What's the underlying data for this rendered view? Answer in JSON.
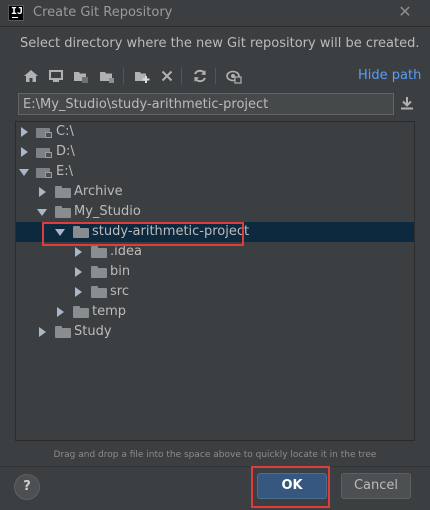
{
  "window": {
    "title": "Create Git Repository",
    "app_icon_letters": "IJ",
    "close_glyph": "✕"
  },
  "description": "Select directory where the new Git repository will be created.",
  "toolbar": {
    "icons": [
      "home-icon",
      "desktop-icon",
      "project-folder-icon",
      "module-folder-icon",
      "new-folder-icon",
      "delete-icon",
      "refresh-icon",
      "show-hidden-icon"
    ],
    "hide_path_label": "Hide path"
  },
  "path_field": {
    "value": "E:\\My_Studio\\study-arithmetic-project"
  },
  "tree": {
    "nodes": [
      {
        "label": "C:\\",
        "kind": "drive",
        "depth": 0,
        "expanded": false
      },
      {
        "label": "D:\\",
        "kind": "drive",
        "depth": 0,
        "expanded": false
      },
      {
        "label": "E:\\",
        "kind": "drive",
        "depth": 0,
        "expanded": true
      },
      {
        "label": "Archive",
        "kind": "folder",
        "depth": 1,
        "expanded": false
      },
      {
        "label": "My_Studio",
        "kind": "folder",
        "depth": 1,
        "expanded": true
      },
      {
        "label": "study-arithmetic-project",
        "kind": "folder",
        "depth": 2,
        "expanded": true,
        "selected": true
      },
      {
        "label": ".idea",
        "kind": "folder",
        "depth": 3,
        "expanded": false
      },
      {
        "label": "bin",
        "kind": "folder",
        "depth": 3,
        "expanded": false
      },
      {
        "label": "src",
        "kind": "folder",
        "depth": 3,
        "expanded": false
      },
      {
        "label": "temp",
        "kind": "folder",
        "depth": 2,
        "expanded": false
      },
      {
        "label": "Study",
        "kind": "folder",
        "depth": 1,
        "expanded": false
      }
    ]
  },
  "hint": "Drag and drop a file into the space above to quickly locate it in the tree",
  "buttons": {
    "help_label": "?",
    "ok_label": "OK",
    "cancel_label": "Cancel"
  },
  "colors": {
    "background": "#3c3f41",
    "selection": "#0d293e",
    "link": "#589df6",
    "ok_button": "#365880",
    "highlight_box": "#e03c3c"
  }
}
